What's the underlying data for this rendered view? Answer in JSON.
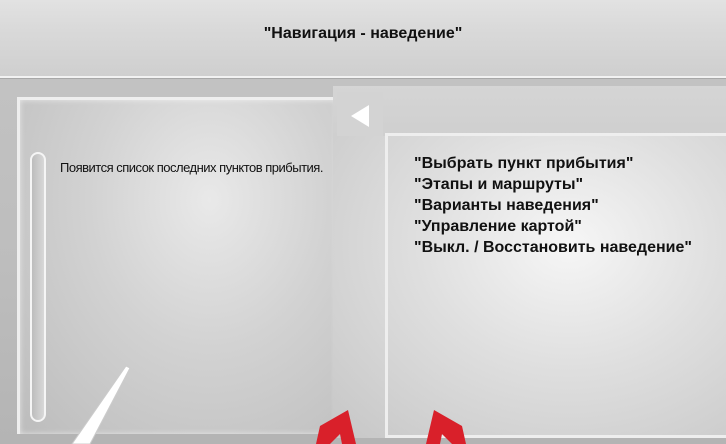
{
  "header": {
    "title": "\"Навигация - наведение\""
  },
  "left_panel": {
    "info_text": "Появится список последних пунктов прибытия."
  },
  "right_panel": {
    "back_icon": "left-triangle-icon",
    "menu_items": [
      {
        "label": "\"Выбрать пункт прибытия\""
      },
      {
        "label": "\"Этапы и маршруты\""
      },
      {
        "label": "\"Варианты наведения\""
      },
      {
        "label": "\"Управление картой\""
      },
      {
        "label": "\"Выкл. / Восстановить наведение\""
      }
    ]
  },
  "colors": {
    "pointer_red": "#d9202a",
    "pointer_white": "#ffffff",
    "text": "#111111"
  }
}
